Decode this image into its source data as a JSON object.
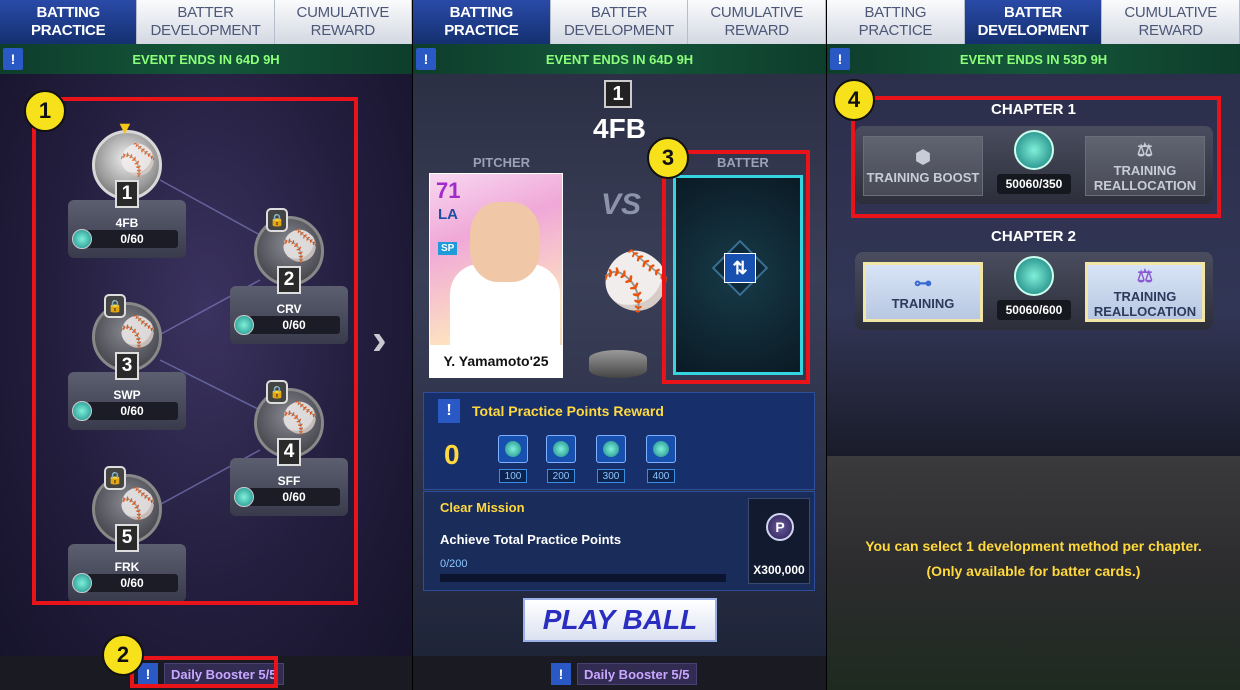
{
  "panels": [
    {
      "tabs": [
        "BATTING PRACTICE",
        "BATTER DEVELOPMENT",
        "CUMULATIVE REWARD"
      ],
      "active_tab": 0,
      "banner": "EVENT ENDS IN 64D 9H",
      "nodes": [
        {
          "number": "1",
          "label": "4FB",
          "progress": "0/60",
          "locked": false
        },
        {
          "number": "2",
          "label": "CRV",
          "progress": "0/60",
          "locked": true
        },
        {
          "number": "3",
          "label": "SWP",
          "progress": "0/60",
          "locked": true
        },
        {
          "number": "4",
          "label": "SFF",
          "progress": "0/60",
          "locked": true
        },
        {
          "number": "5",
          "label": "FRK",
          "progress": "0/60",
          "locked": true
        }
      ],
      "booster": "Daily Booster 5/5"
    },
    {
      "tabs": [
        "BATTING PRACTICE",
        "BATTER DEVELOPMENT",
        "CUMULATIVE REWARD"
      ],
      "active_tab": 0,
      "banner": "EVENT ENDS IN 64D 9H",
      "stage_number": "1",
      "stage_name": "4FB",
      "pitcher_header": "PITCHER",
      "batter_header": "BATTER",
      "vs": "VS",
      "card": {
        "ovr": "71",
        "team": "LA",
        "position": "SP",
        "name": "Y. Yamamoto'25"
      },
      "reward_title": "Total Practice Points Reward",
      "reward_points": "0",
      "reward_tiers": [
        "100",
        "200",
        "300",
        "400"
      ],
      "mission_title": "Clear Mission",
      "mission_desc": "Achieve Total Practice Points",
      "mission_progress": "0/200",
      "mission_reward_icon": "P",
      "mission_reward": "X300,000",
      "play_button": "PLAY BALL",
      "booster": "Daily Booster 5/5"
    },
    {
      "tabs": [
        "BATTING PRACTICE",
        "BATTER DEVELOPMENT",
        "CUMULATIVE REWARD"
      ],
      "active_tab": 1,
      "banner": "EVENT ENDS IN 53D 9H",
      "chapter1": {
        "title": "CHAPTER 1",
        "left": "TRAINING BOOST",
        "count": "50060/350",
        "right": "TRAINING REALLOCATION"
      },
      "chapter2": {
        "title": "CHAPTER 2",
        "left": "TRAINING",
        "count": "50060/600",
        "right": "TRAINING REALLOCATION"
      },
      "note_line1": "You can select 1 development method per chapter.",
      "note_line2": "(Only available for batter cards.)"
    }
  ],
  "markers": [
    "1",
    "2",
    "3",
    "4"
  ],
  "info_glyph": "!",
  "colors": {
    "highlight": "#e8141a",
    "marker": "#f7e11a",
    "banner_text": "#8cff7a",
    "reward_text": "#ffd93d"
  }
}
